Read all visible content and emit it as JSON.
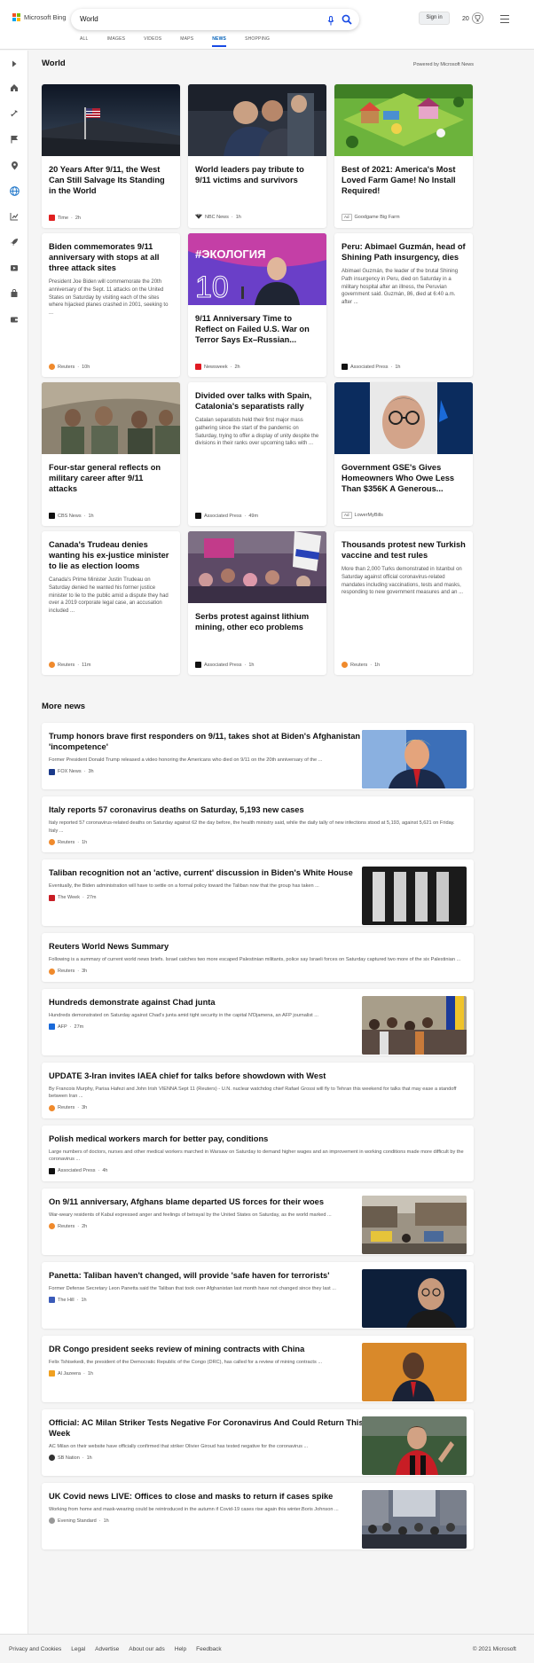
{
  "header": {
    "logo_text": "Microsoft Bing",
    "search_value": "World",
    "signin_label": "Sign in",
    "rewards_points": "20"
  },
  "nav": {
    "tabs": [
      {
        "label": "ALL"
      },
      {
        "label": "IMAGES"
      },
      {
        "label": "VIDEOS"
      },
      {
        "label": "MAPS"
      },
      {
        "label": "NEWS"
      },
      {
        "label": "SHOPPING"
      }
    ]
  },
  "section": {
    "title": "World",
    "powered": "Powered by Microsoft News"
  },
  "cards": [
    {
      "title": "20 Years After 9/11, the West Can Still Salvage Its Standing in the World",
      "desc": "",
      "source": "Time",
      "time": "2h",
      "ad": false
    },
    {
      "title": "World leaders pay tribute to 9/11 victims and survivors",
      "desc": "",
      "source": "NBC News",
      "time": "1h",
      "ad": false
    },
    {
      "title": "Best of 2021: America's Most Loved Farm Game! No Install Required!",
      "desc": "",
      "source": "Goodgame Big Farm",
      "time": "",
      "ad": true,
      "ad_label": "Ad"
    },
    {
      "title": "Biden commemorates 9/11 anniversary with stops at all three attack sites",
      "desc": "President Joe Biden will commemorate the 20th anniversary of the Sept. 11 attacks on the United States on Saturday by visiting each of the sites where hijacked planes crashed in 2001, seeking to ...",
      "source": "Reuters",
      "time": "10h",
      "ad": false
    },
    {
      "title": "9/11 Anniversary Time to Reflect on Failed U.S. War on Terror Says Ex–Russian...",
      "desc": "",
      "source": "Newsweek",
      "time": "2h",
      "ad": false
    },
    {
      "title": "Peru: Abimael Guzmán, head of Shining Path insurgency, dies",
      "desc": "Abimael Guzmán, the leader of the brutal Shining Path insurgency in Peru, died on Saturday in a military hospital after an illness, the Peruvian government said. Guzmán, 86, died at 6:40 a.m. after ...",
      "source": "Associated Press",
      "time": "1h",
      "ad": false
    },
    {
      "title": "Four-star general reflects on military career after 9/11 attacks",
      "desc": "",
      "source": "CBS News",
      "time": "1h",
      "ad": false
    },
    {
      "title": "Divided over talks with Spain, Catalonia's separatists rally",
      "desc": "Catalan separatists held their first major mass gathering since the start of the pandemic on Saturday, trying to offer a display of unity despite the divisions in their ranks over upcoming talks with ...",
      "source": "Associated Press",
      "time": "49m",
      "ad": false
    },
    {
      "title": "Government GSE's Gives Homeowners Who Owe Less Than $356K A Generous...",
      "desc": "",
      "source": "LowerMyBills",
      "time": "",
      "ad": true,
      "ad_label": "Ad"
    },
    {
      "title": "Canada's Trudeau denies wanting his ex-justice minister to lie as election looms",
      "desc": "Canada's Prime Minister Justin Trudeau on Saturday denied he wanted his former justice minister to lie to the public amid a dispute they had over a 2019 corporate legal case, an accusation included ...",
      "source": "Reuters",
      "time": "11m",
      "ad": false
    },
    {
      "title": "Serbs protest against lithium mining, other eco problems",
      "desc": "",
      "source": "Associated Press",
      "time": "1h",
      "ad": false
    },
    {
      "title": "Thousands protest new Turkish vaccine and test rules",
      "desc": "More than 2,000 Turks demonstrated in Istanbul on Saturday against official coronavirus-related mandates including vaccinations, tests and masks, responding to new government measures and an ...",
      "source": "Reuters",
      "time": "1h",
      "ad": false
    }
  ],
  "card_image_text": {
    "eco_banner": "#ЭКОЛОГИЯ",
    "eco_number": "10"
  },
  "more_news": {
    "title": "More news",
    "items": [
      {
        "title": "Trump honors brave first responders on 9/11, takes shot at Biden's Afghanistan 'incompetence'",
        "desc": "Former President Donald Trump released a video honoring the Americans who died on 9/11 on the 20th anniversary of the ...",
        "source": "FOX News",
        "time": "3h"
      },
      {
        "title": "Italy reports 57 coronavirus deaths on Saturday, 5,193 new cases",
        "desc": "Italy reported 57 coronavirus-related deaths on Saturday against 62 the day before, the health ministry said, while the daily tally of new infections stood at 5,193, against 5,621 on Friday. Italy ...",
        "source": "Reuters",
        "time": "1h"
      },
      {
        "title": "Taliban recognition not an 'active, current' discussion in Biden's White House",
        "desc": "Eventually, the Biden administration will have to settle on a formal policy toward the Taliban now that the group has taken ...",
        "source": "The Week",
        "time": "27m"
      },
      {
        "title": "Reuters World News Summary",
        "desc": "Following is a summary of current world news briefs. Israel catches two more escaped Palestinian militants, police say Israeli forces on Saturday captured two more of the six Palestinian ...",
        "source": "Reuters",
        "time": "3h"
      },
      {
        "title": "Hundreds demonstrate against Chad junta",
        "desc": "Hundreds demonstrated on Saturday against Chad's junta amid tight security in the capital N'Djamena, an AFP journalist ...",
        "source": "AFP",
        "time": "27m"
      },
      {
        "title": "UPDATE 3-Iran invites IAEA chief for talks before showdown with West",
        "desc": "By Francois Murphy, Parisa Hafezi and John Irish VIENNA Sept 11 (Reuters) - U.N. nuclear watchdog chief Rafael Grossi will fly to Tehran this weekend for talks that may ease a standoff between Iran ...",
        "source": "Reuters",
        "time": "3h"
      },
      {
        "title": "Polish medical workers march for better pay, conditions",
        "desc": "Large numbers of doctors, nurses and other medical workers marched in Warsaw on Saturday to demand higher wages and an improvement in working conditions made more difficult by the coronavirus ...",
        "source": "Associated Press",
        "time": "4h"
      },
      {
        "title": "On 9/11 anniversary, Afghans blame departed US forces for their woes",
        "desc": "War-weary residents of Kabul expressed anger and feelings of betrayal by the United States on Saturday, as the world marked ...",
        "source": "Reuters",
        "time": "2h"
      },
      {
        "title": "Panetta: Taliban haven't changed, will provide 'safe haven for terrorists'",
        "desc": "Former Defense Secretary Leon Panetta said the Taliban that took over Afghanistan last month have not changed since they last ...",
        "source": "The Hill",
        "time": "1h"
      },
      {
        "title": "DR Congo president seeks review of mining contracts with China",
        "desc": "Felix Tshisekedi, the president of the Democratic Republic of the Congo (DRC), has called for a review of mining contracts ...",
        "source": "Al Jazeera",
        "time": "1h"
      },
      {
        "title": "Official: AC Milan Striker Tests Negative For Coronavirus And Could Return This Week",
        "desc": "AC Milan on their website have officially confirmed that striker Olivier Giroud has tested negative for the coronavirus ...",
        "source": "SB Nation",
        "time": "1h"
      },
      {
        "title": "UK Covid news LIVE: Offices to close and masks to return if cases spike",
        "desc": "Working from home and mask-wearing could be reintroduced in the autumn if Covid-19 cases rise again this winter.Boris Johnson ...",
        "source": "Evening Standard",
        "time": "1h"
      }
    ]
  },
  "footer": {
    "links": [
      "Privacy and Cookies",
      "Legal",
      "Advertise",
      "About our ads",
      "Help",
      "Feedback"
    ],
    "copyright": "© 2021 Microsoft"
  },
  "colors": {
    "accent": "#174ae4",
    "link_active": "#005fb8",
    "background": "#f5f5f5"
  }
}
